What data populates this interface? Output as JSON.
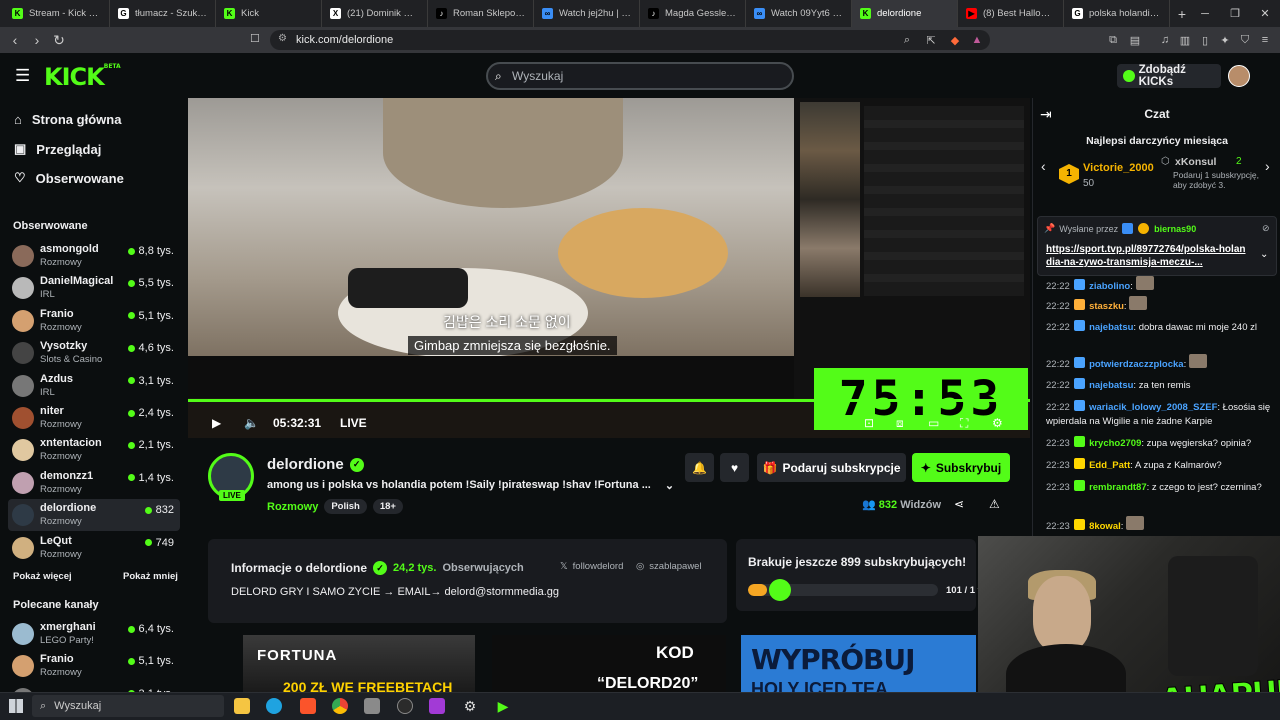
{
  "browser": {
    "tabs": [
      {
        "title": "Stream - Kick Dashb",
        "color": "#53fc18",
        "icon": "K"
      },
      {
        "title": "tłumacz - Szukaj w G",
        "color": "#ffffff",
        "icon": "G"
      },
      {
        "title": "Kick",
        "color": "#53fc18",
        "icon": "K"
      },
      {
        "title": "(21) Dominik Walbr",
        "color": "#ffffff",
        "icon": "X"
      },
      {
        "title": "Roman Sklepowicz",
        "color": "#000000",
        "icon": "♪"
      },
      {
        "title": "Watch jej2hu | Strea",
        "color": "#3a8ef6",
        "icon": "∞"
      },
      {
        "title": "Magda Gessler AleG",
        "color": "#000000",
        "icon": "♪"
      },
      {
        "title": "Watch 09Yyt6 | Strea",
        "color": "#3a8ef6",
        "icon": "∞"
      },
      {
        "title": "delordione",
        "color": "#53fc18",
        "icon": "K",
        "active": true
      },
      {
        "title": "(8) Best Halloween (",
        "color": "#ff0000",
        "icon": "▶"
      },
      {
        "title": "polska holandia - Sz",
        "color": "#ffffff",
        "icon": "G"
      }
    ],
    "url": "kick.com/delordione"
  },
  "header": {
    "logo": "KICK",
    "logo_sup": "BETA",
    "search_placeholder": "Wyszukaj",
    "kicks_button": "Zdobądź KICKs"
  },
  "sidebar": {
    "nav": [
      {
        "label": "Strona główna",
        "icon": "⌂"
      },
      {
        "label": "Przeglądaj",
        "icon": "▣"
      },
      {
        "label": "Obserwowane",
        "icon": "♡"
      }
    ],
    "followed_heading": "Obserwowane",
    "followed": [
      {
        "name": "asmongold",
        "category": "Rozmowy",
        "viewers": "8,8 tys.",
        "color": "#8a6a5a"
      },
      {
        "name": "DanielMagical",
        "category": "IRL",
        "viewers": "5,5 tys.",
        "color": "#b9b9b9"
      },
      {
        "name": "Franio",
        "category": "Rozmowy",
        "viewers": "5,1 tys.",
        "color": "#d4a070"
      },
      {
        "name": "Vysotzky",
        "category": "Slots & Casino",
        "viewers": "4,6 tys.",
        "color": "#444444"
      },
      {
        "name": "Azdus",
        "category": "IRL",
        "viewers": "3,1 tys.",
        "color": "#777777"
      },
      {
        "name": "niter",
        "category": "Rozmowy",
        "viewers": "2,4 tys.",
        "color": "#a05030"
      },
      {
        "name": "xntentacion",
        "category": "Rozmowy",
        "viewers": "2,1 tys.",
        "color": "#e0c8a0"
      },
      {
        "name": "demonzz1",
        "category": "Rozmowy",
        "viewers": "1,4 tys.",
        "color": "#c0a0b0"
      },
      {
        "name": "delordione",
        "category": "Rozmowy",
        "viewers": "832",
        "color": "#2e3a46",
        "active": true
      },
      {
        "name": "LeQut",
        "category": "Rozmowy",
        "viewers": "749",
        "color": "#d0b080"
      }
    ],
    "show_more": "Pokaż więcej",
    "show_less": "Pokaż mniej",
    "recommended_heading": "Polecane kanały",
    "recommended": [
      {
        "name": "xmerghani",
        "category": "LEGO Party!",
        "viewers": "6,4 tys.",
        "color": "#9bbbd0"
      },
      {
        "name": "Franio",
        "category": "Rozmowy",
        "viewers": "5,1 tys.",
        "color": "#d4a070"
      },
      {
        "name": "Azdus",
        "category": "",
        "viewers": "3,1 tys.",
        "color": "#777777"
      }
    ]
  },
  "video": {
    "subtitle_korean": "김밥은 소리 소문 없이",
    "subtitle_polish": "Gimbap zmniejsza się bezgłośnie.",
    "timer": "75:53",
    "time": "05:32:31",
    "live": "LIVE"
  },
  "channel": {
    "name": "delordione",
    "live_badge": "LIVE",
    "stream_title": "among us i polska vs holandia potem !Saily !pirateswap !shav !Fortuna ...",
    "category": "Rozmowy",
    "tags": [
      "Polish",
      "18+"
    ],
    "gift_button": "Podaruj subskrypcje",
    "subscribe_button": "Subskrybuj",
    "viewers": "832",
    "viewers_label": "Widzów"
  },
  "about": {
    "title": "Informacje o delordione",
    "followers": "24,2 tys.",
    "followers_label": "Obserwujących",
    "x_handle": "followdelord",
    "ig_handle": "szablapawel",
    "bio": "DELORD GRY I SAMO ZYCIE → EMAIL→ delord@stormmedia.gg"
  },
  "goal": {
    "title": "Brakuje jeszcze 899 subskrybujących!",
    "progress": "101 / 1 t",
    "fraction": 0.1
  },
  "banners": {
    "fortuna": "FORTUNA",
    "fortuna_sub": "200 ZŁ WE FREEBETACH",
    "kod": "KOD",
    "kod_code": "“DELORD20”",
    "tea": "WYPRÓBUJ",
    "tea_sub": "HOLY ICED TEA"
  },
  "chat": {
    "title": "Czat",
    "top_title": "Najlepsi darczyńcy miesiąca",
    "top1_name": "Victorie_2000",
    "top1_amount": "50",
    "top2_name": "xKonsul",
    "top2_amount": "2",
    "top2_note": "Podaruj 1 subskrypcję, aby zdobyć 3.",
    "pinned_by_label": "Wysłane przez",
    "pinned_by": "biernas90",
    "pinned_link": "https://sport.tvp.pl/89772764/polska-holandia-na-zywo-transmisja-meczu-...",
    "messages": [
      {
        "time": "22:22",
        "user": "ziabolino",
        "text": "",
        "color": "#4aa3ff"
      },
      {
        "time": "22:22",
        "user": "staszku",
        "text": "",
        "color": "#ffb03a"
      },
      {
        "time": "22:22",
        "user": "najebatsu",
        "text": "dobra dawac mi moje 240 zl",
        "color": "#4aa3ff"
      },
      {
        "time": "22:22",
        "user": "potwierdzaczzplocka",
        "text": "",
        "color": "#4aa3ff"
      },
      {
        "time": "22:22",
        "user": "najebatsu",
        "text": "za ten remis",
        "color": "#4aa3ff"
      },
      {
        "time": "22:22",
        "user": "wariacik_lolowy_2008_SZEF",
        "text": "Łosośia się wpierdala na Wigilie a nie żadne Karpie",
        "color": "#4aa3ff"
      },
      {
        "time": "22:23",
        "user": "krycho2709",
        "text": "zupa węgierska? opinia?",
        "color": "#53fc18"
      },
      {
        "time": "22:23",
        "user": "Edd_Patt",
        "text": "A zupa z Kalmarów?",
        "color": "#ffd700"
      },
      {
        "time": "22:23",
        "user": "rembrandt87",
        "text": "z czego to jest? czernina?",
        "color": "#53fc18"
      },
      {
        "time": "22:23",
        "user": "8kowal",
        "text": "",
        "color": "#ffd700"
      }
    ]
  },
  "overlay": {
    "brand": "AHAPULCO"
  },
  "taskbar": {
    "search": "Wyszukaj"
  }
}
